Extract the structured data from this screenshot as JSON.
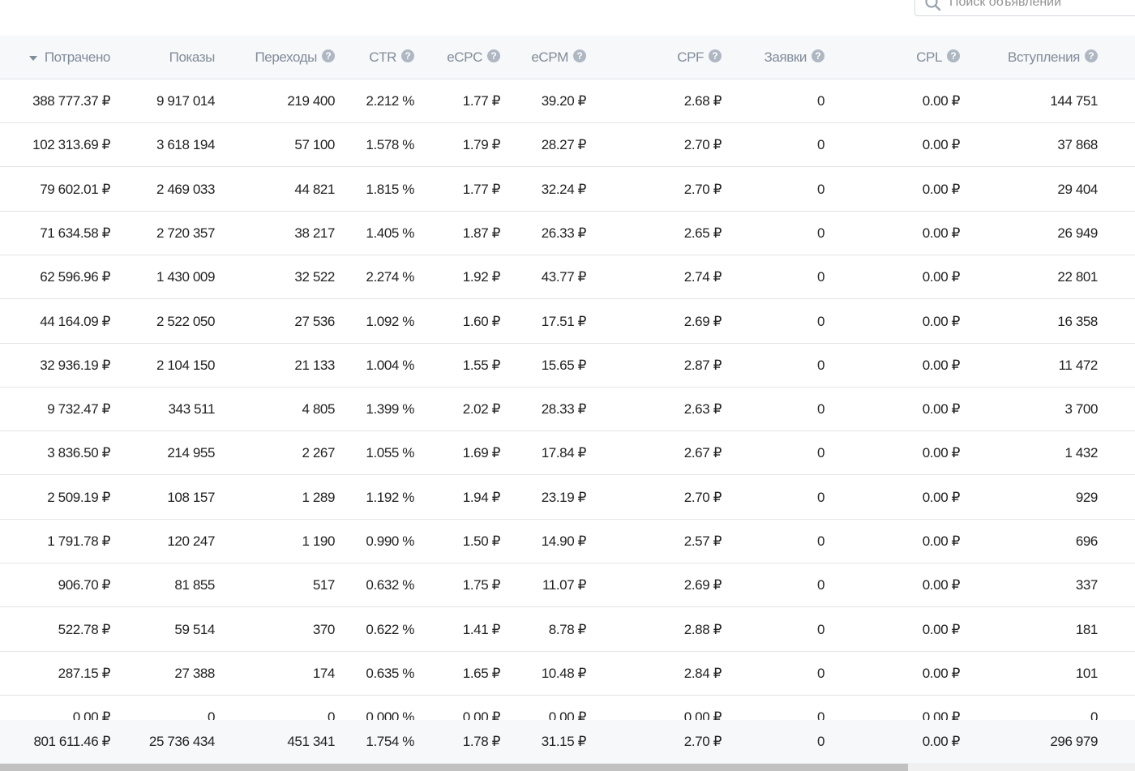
{
  "search": {
    "placeholder": "Поиск объявлений"
  },
  "table": {
    "columns": [
      {
        "key": "spent",
        "label": "Потрачено",
        "sorted": "desc",
        "help": false
      },
      {
        "key": "impressions",
        "label": "Показы",
        "help": false
      },
      {
        "key": "clicks",
        "label": "Переходы",
        "help": true
      },
      {
        "key": "ctr",
        "label": "CTR",
        "help": true
      },
      {
        "key": "ecpc",
        "label": "eCPC",
        "help": true
      },
      {
        "key": "ecpm",
        "label": "eCPM",
        "help": true
      },
      {
        "key": "cpf",
        "label": "CPF",
        "help": true
      },
      {
        "key": "leads",
        "label": "Заявки",
        "help": true
      },
      {
        "key": "cpl",
        "label": "CPL",
        "help": true
      },
      {
        "key": "joins",
        "label": "Вступления",
        "help": true
      }
    ],
    "help_glyph": "?",
    "rows": [
      [
        "388 777.37 ₽",
        "9 917 014",
        "219 400",
        "2.212 %",
        "1.77 ₽",
        "39.20 ₽",
        "2.68 ₽",
        "0",
        "0.00 ₽",
        "144 751"
      ],
      [
        "102 313.69 ₽",
        "3 618 194",
        "57 100",
        "1.578 %",
        "1.79 ₽",
        "28.27 ₽",
        "2.70 ₽",
        "0",
        "0.00 ₽",
        "37 868"
      ],
      [
        "79 602.01 ₽",
        "2 469 033",
        "44 821",
        "1.815 %",
        "1.77 ₽",
        "32.24 ₽",
        "2.70 ₽",
        "0",
        "0.00 ₽",
        "29 404"
      ],
      [
        "71 634.58 ₽",
        "2 720 357",
        "38 217",
        "1.405 %",
        "1.87 ₽",
        "26.33 ₽",
        "2.65 ₽",
        "0",
        "0.00 ₽",
        "26 949"
      ],
      [
        "62 596.96 ₽",
        "1 430 009",
        "32 522",
        "2.274 %",
        "1.92 ₽",
        "43.77 ₽",
        "2.74 ₽",
        "0",
        "0.00 ₽",
        "22 801"
      ],
      [
        "44 164.09 ₽",
        "2 522 050",
        "27 536",
        "1.092 %",
        "1.60 ₽",
        "17.51 ₽",
        "2.69 ₽",
        "0",
        "0.00 ₽",
        "16 358"
      ],
      [
        "32 936.19 ₽",
        "2 104 150",
        "21 133",
        "1.004 %",
        "1.55 ₽",
        "15.65 ₽",
        "2.87 ₽",
        "0",
        "0.00 ₽",
        "11 472"
      ],
      [
        "9 732.47 ₽",
        "343 511",
        "4 805",
        "1.399 %",
        "2.02 ₽",
        "28.33 ₽",
        "2.63 ₽",
        "0",
        "0.00 ₽",
        "3 700"
      ],
      [
        "3 836.50 ₽",
        "214 955",
        "2 267",
        "1.055 %",
        "1.69 ₽",
        "17.84 ₽",
        "2.67 ₽",
        "0",
        "0.00 ₽",
        "1 432"
      ],
      [
        "2 509.19 ₽",
        "108 157",
        "1 289",
        "1.192 %",
        "1.94 ₽",
        "23.19 ₽",
        "2.70 ₽",
        "0",
        "0.00 ₽",
        "929"
      ],
      [
        "1 791.78 ₽",
        "120 247",
        "1 190",
        "0.990 %",
        "1.50 ₽",
        "14.90 ₽",
        "2.57 ₽",
        "0",
        "0.00 ₽",
        "696"
      ],
      [
        "906.70 ₽",
        "81 855",
        "517",
        "0.632 %",
        "1.75 ₽",
        "11.07 ₽",
        "2.69 ₽",
        "0",
        "0.00 ₽",
        "337"
      ],
      [
        "522.78 ₽",
        "59 514",
        "370",
        "0.622 %",
        "1.41 ₽",
        "8.78 ₽",
        "2.88 ₽",
        "0",
        "0.00 ₽",
        "181"
      ],
      [
        "287.15 ₽",
        "27 388",
        "174",
        "0.635 %",
        "1.65 ₽",
        "10.48 ₽",
        "2.84 ₽",
        "0",
        "0.00 ₽",
        "101"
      ],
      [
        "0.00 ₽",
        "0",
        "0",
        "0.000 %",
        "0.00 ₽",
        "0.00 ₽",
        "0.00 ₽",
        "0",
        "0.00 ₽",
        "0"
      ]
    ],
    "totals": [
      "801 611.46 ₽",
      "25 736 434",
      "451 341",
      "1.754 %",
      "1.78 ₽",
      "31.15 ₽",
      "2.70 ₽",
      "0",
      "0.00 ₽",
      "296 979"
    ]
  },
  "horizontal_scroll": {
    "visible_fraction": 0.8,
    "position": 0
  }
}
